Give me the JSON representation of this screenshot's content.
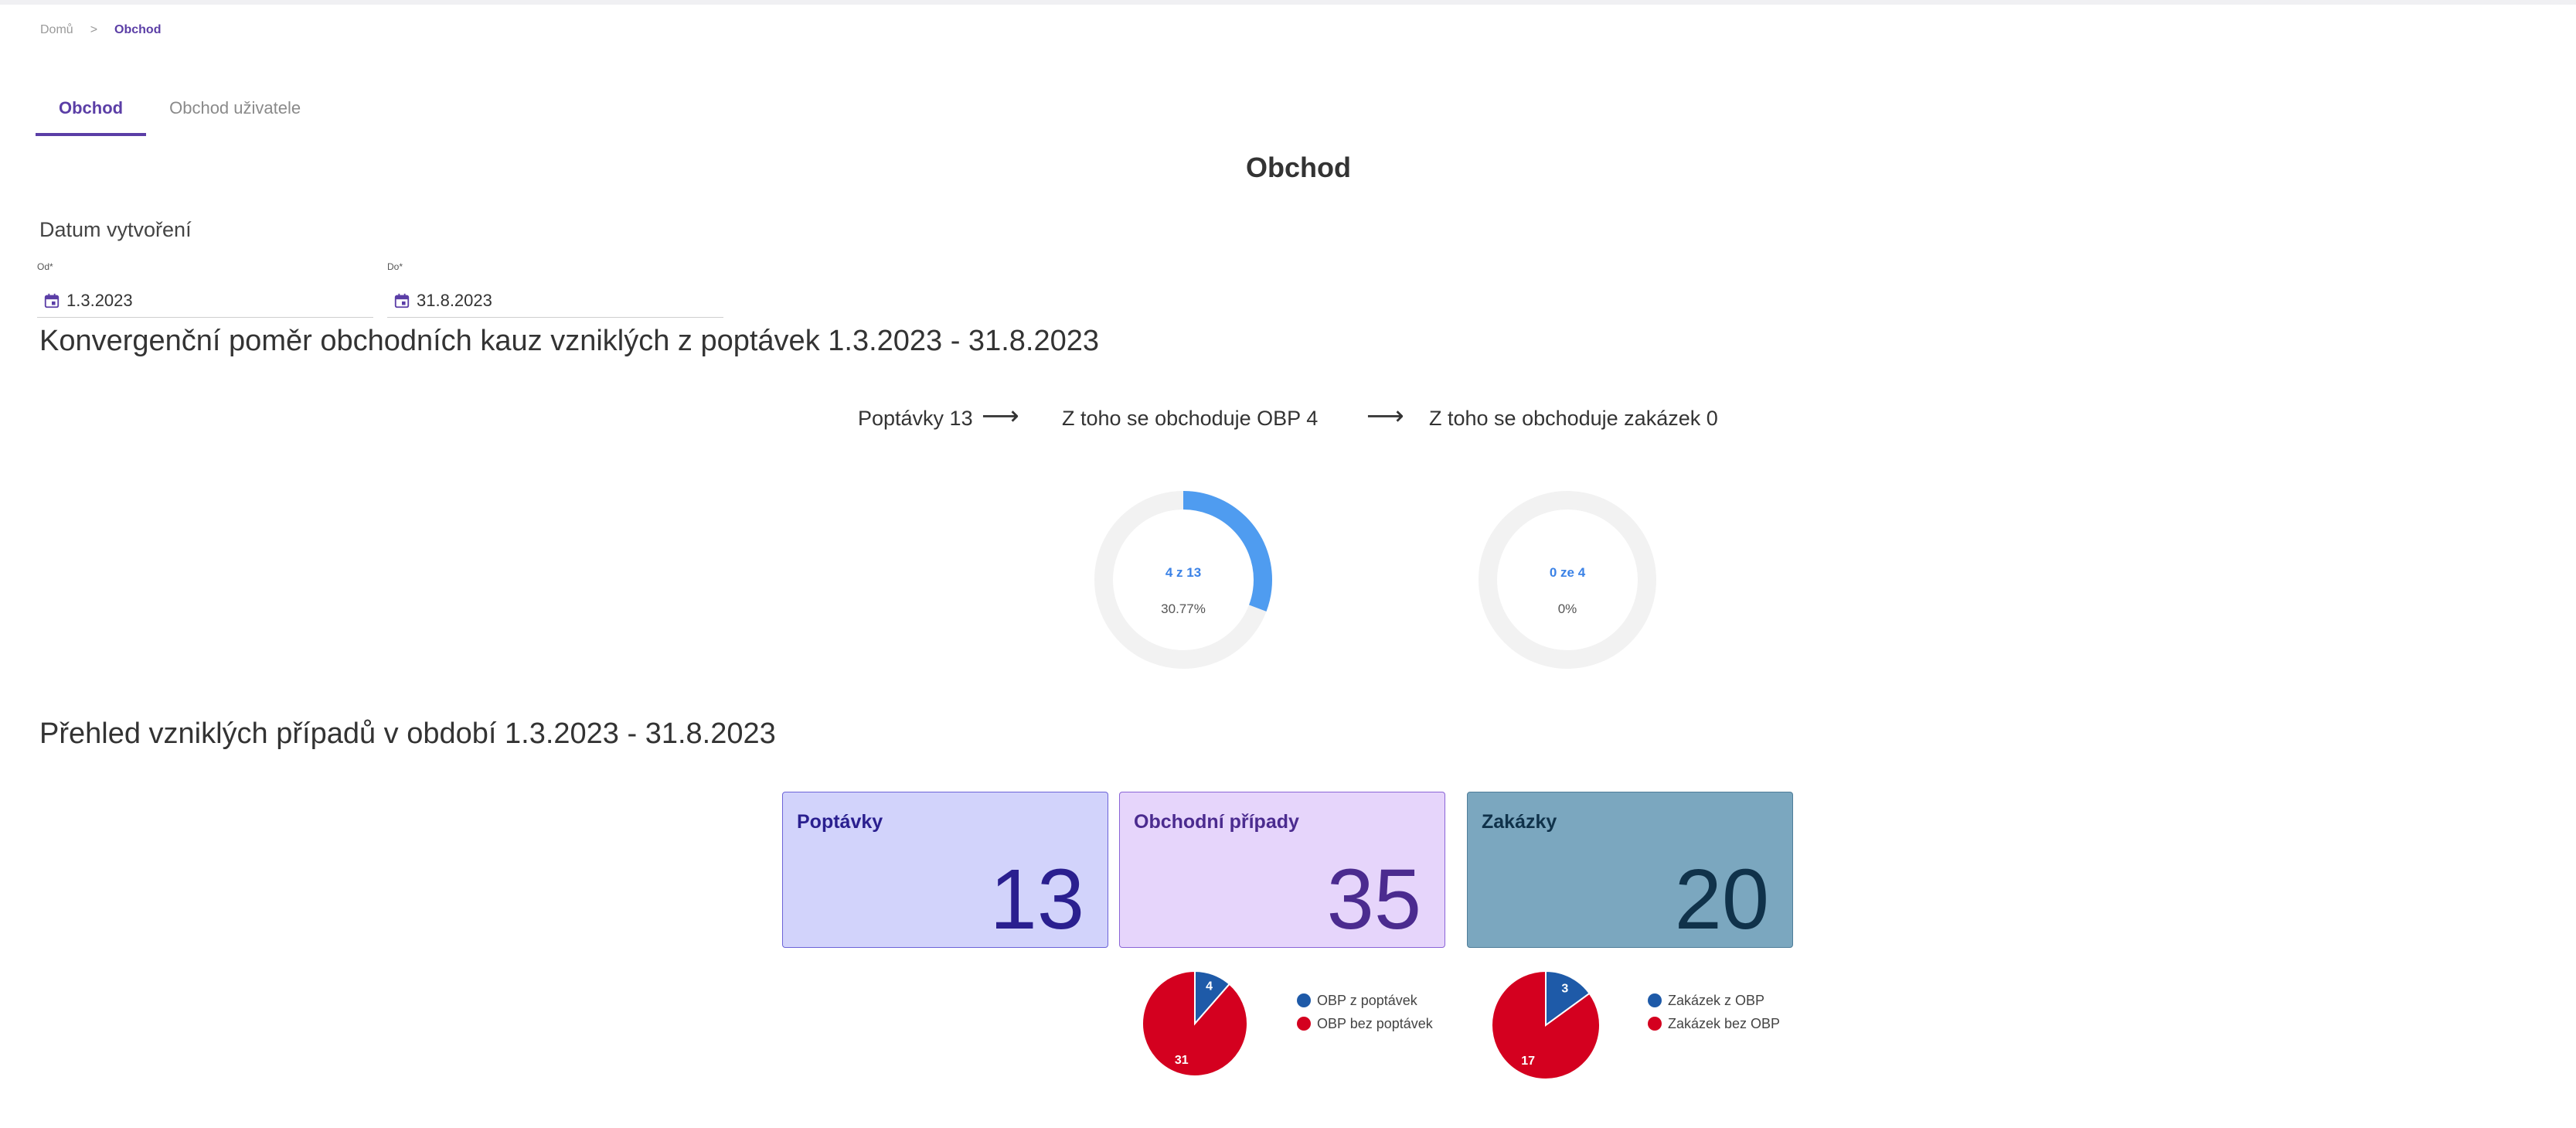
{
  "breadcrumb": {
    "home": "Domů",
    "separator": ">",
    "current": "Obchod"
  },
  "tabs": [
    {
      "label": "Obchod",
      "active": true
    },
    {
      "label": "Obchod uživatele",
      "active": false
    }
  ],
  "page_title": "Obchod",
  "filters": {
    "section_label": "Datum vytvoření",
    "from": {
      "label": "Od*",
      "value": "1.3.2023",
      "icon": "calendar-icon"
    },
    "to": {
      "label": "Do*",
      "value": "31.8.2023",
      "icon": "calendar-icon"
    }
  },
  "conversion": {
    "heading": "Konvergenční poměr obchodních kauz vzniklých z poptávek 1.3.2023 - 31.8.2023",
    "step1": "Poptávky 13",
    "step2": "Z toho se obchoduje OBP 4",
    "step3": "Z toho se obchoduje zakázek 0",
    "arrow": "⟶",
    "donut1": {
      "text": "4 z 13",
      "pct": "30.77%",
      "fraction": 0.3077
    },
    "donut2": {
      "text": "0 ze 4",
      "pct": "0%",
      "fraction": 0
    },
    "colors": {
      "accent": "#4f9cf0",
      "track": "#f2f2f2"
    }
  },
  "overview": {
    "heading": "Přehled vzniklých případů v období 1.3.2023 - 31.8.2023",
    "cards": [
      {
        "title": "Poptávky",
        "value": "13",
        "bg": "#d2d3fb",
        "border": "#6b63d8",
        "fg": "#2a1f8f"
      },
      {
        "title": "Obchodní případy",
        "value": "35",
        "bg": "#e6d5fb",
        "border": "#8a64d6",
        "fg": "#4b2b8f"
      },
      {
        "title": "Zakázky",
        "value": "20",
        "bg": "#7ba7bf",
        "border": "#4f7d99",
        "fg": "#10324a"
      }
    ]
  },
  "chart_data": [
    {
      "type": "pie",
      "slices": [
        {
          "name": "OBP z poptávek",
          "value": 4,
          "color": "#1e5aa8"
        },
        {
          "name": "OBP bez poptávek",
          "value": 31,
          "color": "#d4001f"
        }
      ]
    },
    {
      "type": "pie",
      "slices": [
        {
          "name": "Zakázek z OBP",
          "value": 3,
          "color": "#1e5aa8"
        },
        {
          "name": "Zakázek bez OBP",
          "value": 17,
          "color": "#d4001f"
        }
      ]
    }
  ]
}
